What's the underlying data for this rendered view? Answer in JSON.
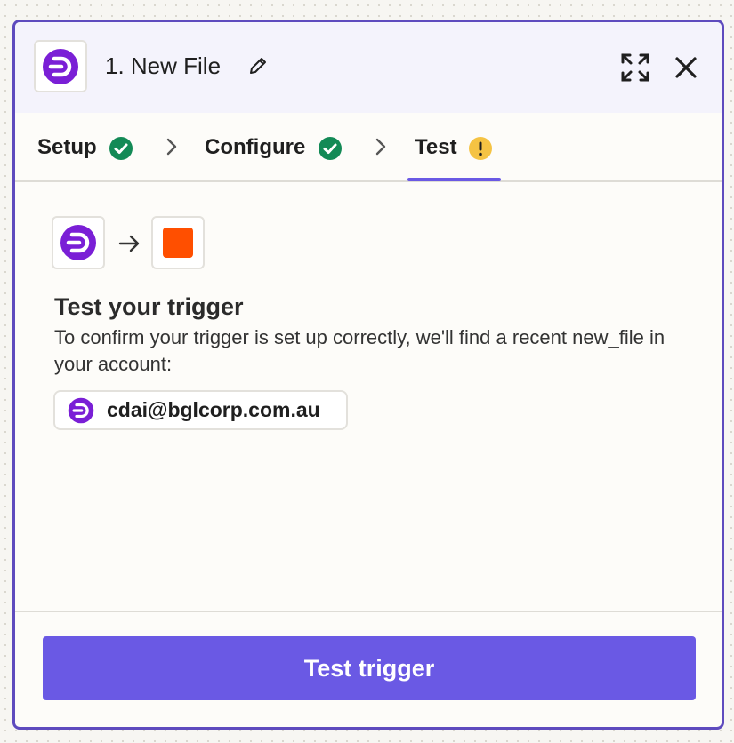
{
  "header": {
    "title": "1. New File",
    "app_icon": "dropbox-like-app-icon"
  },
  "tabs": [
    {
      "label": "Setup",
      "status": "complete"
    },
    {
      "label": "Configure",
      "status": "complete"
    },
    {
      "label": "Test",
      "status": "warning",
      "active": true
    }
  ],
  "flow": {
    "source_icon": "app-icon",
    "target_icon": "zapier-orange-square-icon"
  },
  "test_section": {
    "title": "Test your trigger",
    "description": "To confirm your trigger is set up correctly, we'll find a recent new_file in your account:",
    "account_label": "cdai@bglcorp.com.au"
  },
  "footer": {
    "button_label": "Test trigger"
  },
  "colors": {
    "accent": "#6a59e4",
    "border_accent": "#5e4bbe",
    "brand_purple": "#7a1fd6",
    "success": "#138a56",
    "warning": "#f5c343",
    "orange": "#ff4f00"
  }
}
